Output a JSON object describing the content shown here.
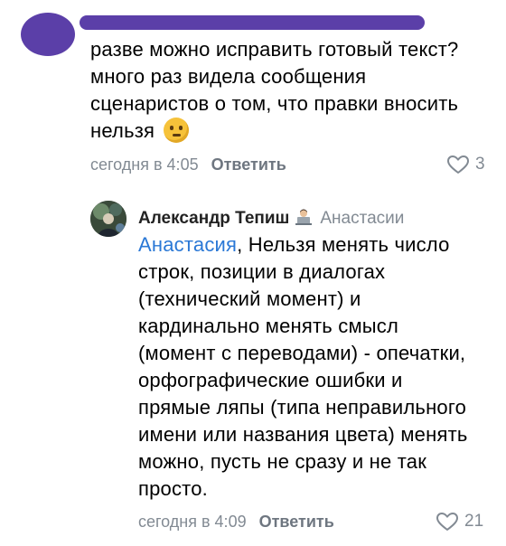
{
  "comment1": {
    "text": "разве можно исправить готовый текст? много раз видела сообщения сценаристов о том, что правки вносить нельзя",
    "emoji": "thinking-face",
    "time": "сегодня в 4:05",
    "reply_label": "Ответить",
    "likes": "3"
  },
  "comment2": {
    "author": "Александр Тепиш",
    "author_emoji": "technologist",
    "recipient": "Анастасии",
    "mention": "Анастасия",
    "text": ", Нельзя менять число строк, позиции в диалогах (технический момент) и кардинально менять смысл (момент с переводами) - опечатки, орфографические ошибки и прямые ляпы (типа неправильного имени или названия цвета) менять можно, пусть не сразу и не так просто.",
    "time": "сегодня в 4:09",
    "reply_label": "Ответить",
    "likes": "21"
  },
  "colors": {
    "mention": "#2a78d6",
    "meta": "#828a93",
    "redaction": "#5b3fa8"
  }
}
